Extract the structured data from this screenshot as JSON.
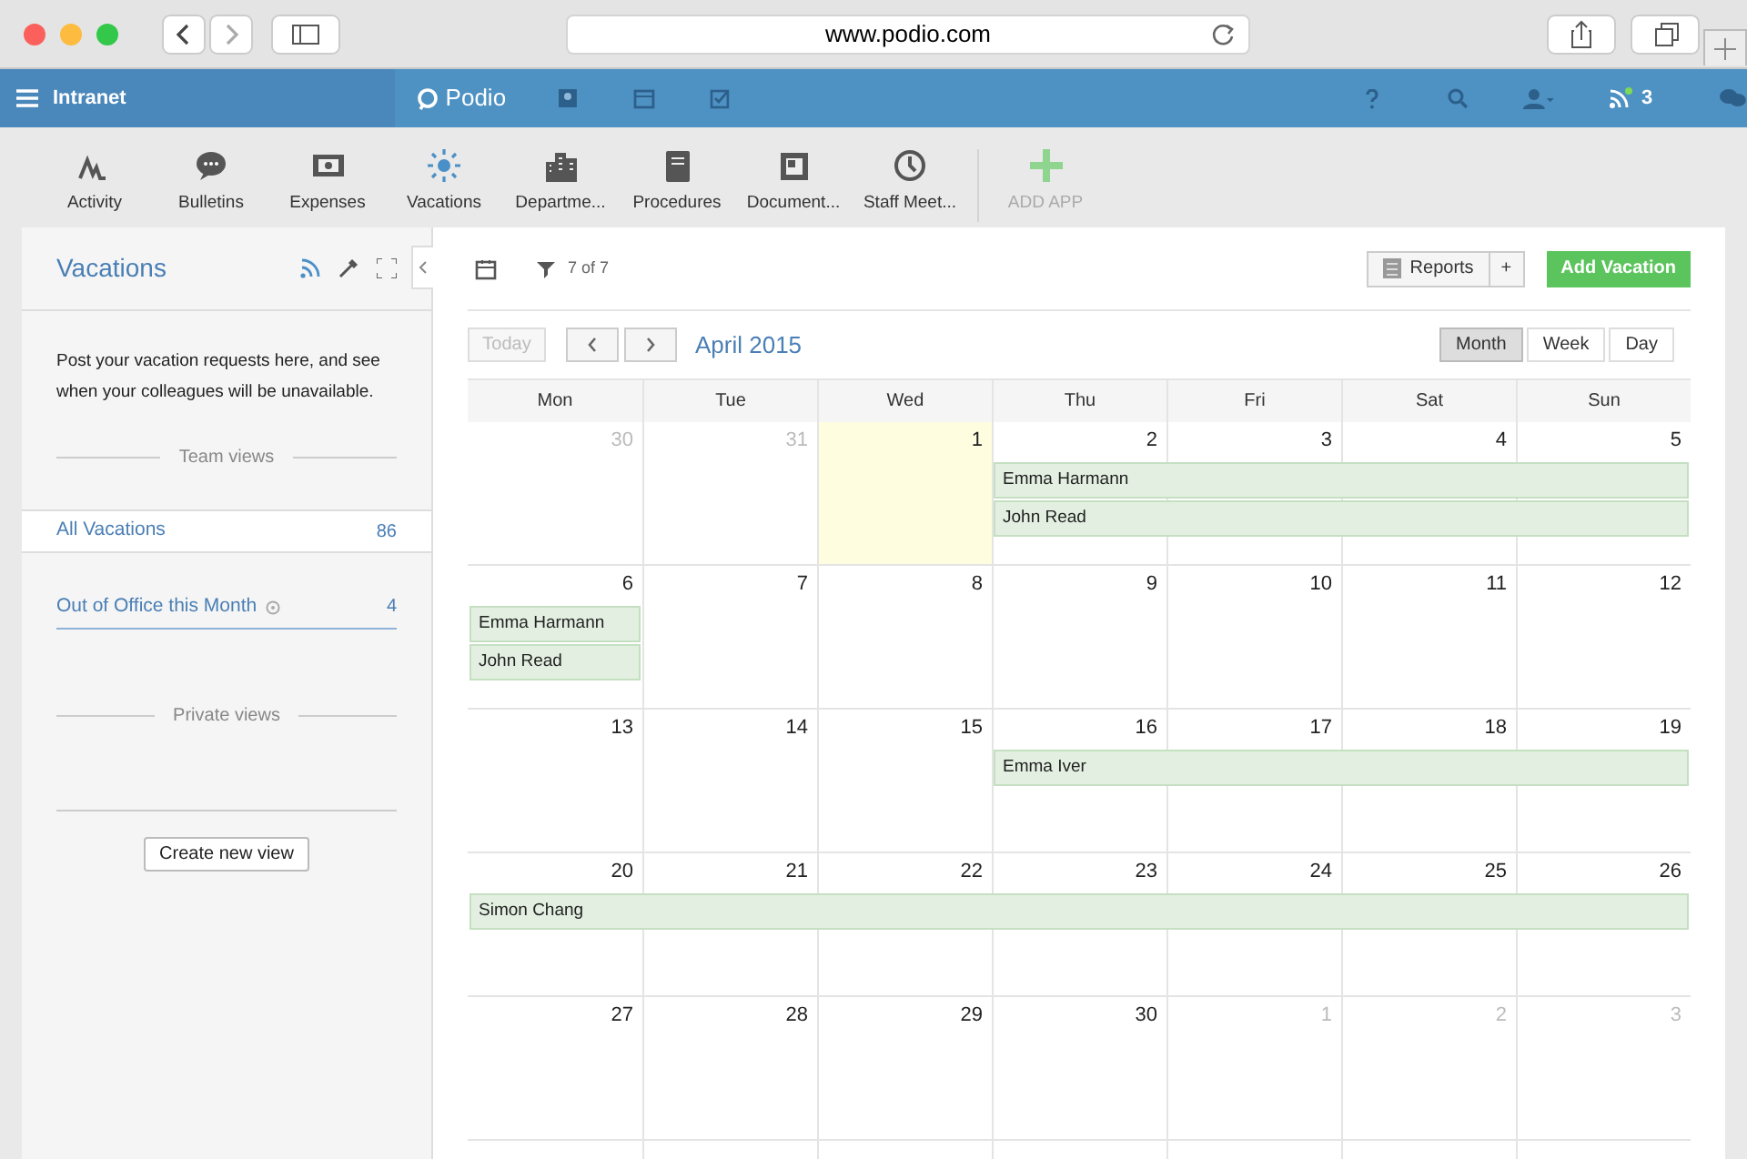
{
  "browser": {
    "url": "www.podio.com"
  },
  "topbar": {
    "workspace": "Intranet",
    "brand": "Podio",
    "notification_count": "3"
  },
  "apps": [
    {
      "label": "Activity",
      "kind": "activity",
      "selected": false
    },
    {
      "label": "Bulletins",
      "kind": "bulletins",
      "selected": false
    },
    {
      "label": "Expenses",
      "kind": "expenses",
      "selected": false
    },
    {
      "label": "Vacations",
      "kind": "vacations",
      "selected": true
    },
    {
      "label": "Departme...",
      "kind": "departments",
      "selected": false
    },
    {
      "label": "Procedures",
      "kind": "procedures",
      "selected": false
    },
    {
      "label": "Document...",
      "kind": "documents",
      "selected": false
    },
    {
      "label": "Staff Meet...",
      "kind": "meetings",
      "selected": false
    },
    {
      "label": "ADD APP",
      "kind": "add",
      "selected": false
    }
  ],
  "sidebar": {
    "title": "Vacations",
    "description": "Post your vacation requests here, and see when your colleagues will be unavailable.",
    "team_views_label": "Team views",
    "views": [
      {
        "label": "All Vacations",
        "count": "86",
        "selected": true,
        "kind": "plain"
      },
      {
        "label": "Out of Office this Month",
        "count": "4",
        "selected": false,
        "kind": "filtered"
      }
    ],
    "private_views_label": "Private views",
    "create_button": "Create new view"
  },
  "toolbar": {
    "filter_count": "7 of 7",
    "reports_button": "Reports",
    "add_report_button": "+",
    "primary_button": "Add Vacation"
  },
  "calendar": {
    "today_button": "Today",
    "today_disabled": true,
    "month": "April 2015",
    "views": [
      {
        "label": "Month",
        "selected": true
      },
      {
        "label": "Week",
        "selected": false
      },
      {
        "label": "Day",
        "selected": false
      }
    ],
    "weekdays": [
      "Mon",
      "Tue",
      "Wed",
      "Thu",
      "Fri",
      "Sat",
      "Sun"
    ],
    "weeks": [
      {
        "days": [
          {
            "date": "30",
            "muted": true,
            "today": false
          },
          {
            "date": "31",
            "muted": true,
            "today": false
          },
          {
            "date": "1",
            "muted": false,
            "today": true
          },
          {
            "date": "2",
            "muted": false,
            "today": false,
            "events": [
              {
                "name": "Emma Harmann",
                "to_week_end": true
              },
              {
                "name": "John Read",
                "to_week_end": true
              }
            ]
          },
          {
            "date": "3",
            "muted": false,
            "today": false
          },
          {
            "date": "4",
            "muted": false,
            "today": false
          },
          {
            "date": "5",
            "muted": false,
            "today": false
          }
        ]
      },
      {
        "days": [
          {
            "date": "6",
            "muted": false,
            "today": false,
            "events": [
              {
                "name": "Emma Harmann",
                "to_week_end": false
              },
              {
                "name": "John Read",
                "to_week_end": false
              }
            ]
          },
          {
            "date": "7",
            "muted": false,
            "today": false
          },
          {
            "date": "8",
            "muted": false,
            "today": false
          },
          {
            "date": "9",
            "muted": false,
            "today": false
          },
          {
            "date": "10",
            "muted": false,
            "today": false
          },
          {
            "date": "11",
            "muted": false,
            "today": false
          },
          {
            "date": "12",
            "muted": false,
            "today": false
          }
        ]
      },
      {
        "days": [
          {
            "date": "13",
            "muted": false,
            "today": false
          },
          {
            "date": "14",
            "muted": false,
            "today": false
          },
          {
            "date": "15",
            "muted": false,
            "today": false
          },
          {
            "date": "16",
            "muted": false,
            "today": false,
            "events": [
              {
                "name": "Emma Iver",
                "to_week_end": true
              }
            ]
          },
          {
            "date": "17",
            "muted": false,
            "today": false
          },
          {
            "date": "18",
            "muted": false,
            "today": false
          },
          {
            "date": "19",
            "muted": false,
            "today": false
          }
        ]
      },
      {
        "days": [
          {
            "date": "20",
            "muted": false,
            "today": false,
            "events": [
              {
                "name": "Simon Chang",
                "to_week_end": true
              }
            ]
          },
          {
            "date": "21",
            "muted": false,
            "today": false
          },
          {
            "date": "22",
            "muted": false,
            "today": false
          },
          {
            "date": "23",
            "muted": false,
            "today": false
          },
          {
            "date": "24",
            "muted": false,
            "today": false
          },
          {
            "date": "25",
            "muted": false,
            "today": false
          },
          {
            "date": "26",
            "muted": false,
            "today": false
          }
        ]
      },
      {
        "days": [
          {
            "date": "27",
            "muted": false,
            "today": false
          },
          {
            "date": "28",
            "muted": false,
            "today": false
          },
          {
            "date": "29",
            "muted": false,
            "today": false
          },
          {
            "date": "30",
            "muted": false,
            "today": false
          },
          {
            "date": "1",
            "muted": true,
            "today": false
          },
          {
            "date": "2",
            "muted": true,
            "today": false
          },
          {
            "date": "3",
            "muted": true,
            "today": false
          }
        ]
      }
    ]
  }
}
